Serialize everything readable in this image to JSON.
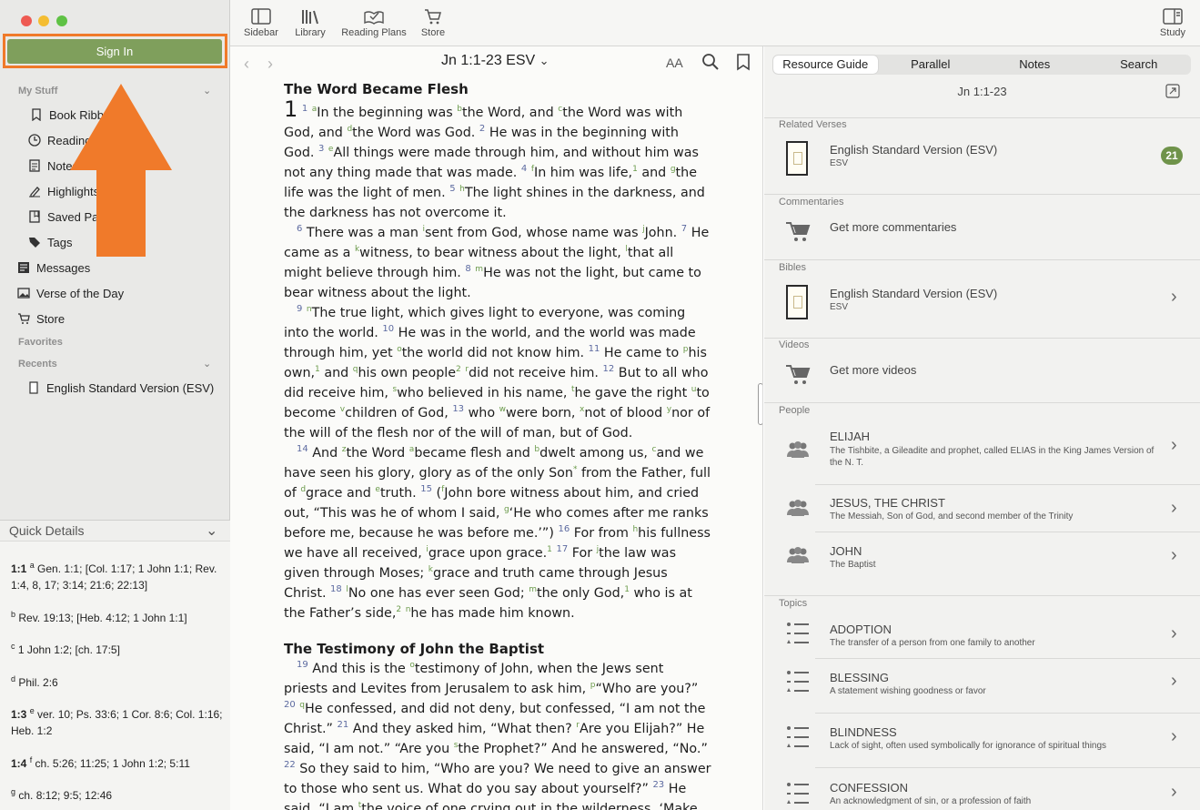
{
  "sidebar": {
    "sign_in": "Sign In",
    "my_stuff_label": "My Stuff",
    "my_stuff": [
      "Book Ribbons",
      "Reading Plans",
      "Notes",
      "Highlights",
      "Saved Passages",
      "Tags"
    ],
    "messages": "Messages",
    "verse_of_day": "Verse of the Day",
    "store": "Store",
    "favorites_label": "Favorites",
    "recents_label": "Recents",
    "recent_item": "English Standard Version (ESV)"
  },
  "quick_details": {
    "title": "Quick Details",
    "entries": [
      {
        "ref": "1:1",
        "note": "a",
        "text": "Gen. 1:1; [Col. 1:17; 1 John 1:1; Rev. 1:4, 8, 17; 3:14; 21:6; 22:13]"
      },
      {
        "ref": "",
        "note": "b",
        "text": "Rev. 19:13; [Heb. 4:12; 1 John 1:1]"
      },
      {
        "ref": "",
        "note": "c",
        "text": "1 John 1:2; [ch. 17:5]"
      },
      {
        "ref": "",
        "note": "d",
        "text": "Phil. 2:6"
      },
      {
        "ref": "1:3",
        "note": "e",
        "text": "ver. 10; Ps. 33:6; 1 Cor. 8:6; Col. 1:16; Heb. 1:2"
      },
      {
        "ref": "1:4",
        "note": "f",
        "text": "ch. 5:26; 11:25; 1 John 1:2; 5:11"
      },
      {
        "ref": "",
        "note": "g",
        "text": "ch. 8:12; 9:5; 12:46"
      }
    ]
  },
  "toolbar": {
    "sidebar": "Sidebar",
    "library": "Library",
    "reading_plans": "Reading Plans",
    "store": "Store",
    "study": "Study"
  },
  "reader": {
    "reference": "Jn 1:1-23 ESV",
    "font_label": "AA",
    "heading1": "The Word Became Flesh",
    "heading2": "The Testimony of John the Baptist"
  },
  "panel": {
    "tabs": [
      "Resource Guide",
      "Parallel",
      "Notes",
      "Search"
    ],
    "reference": "Jn 1:1-23",
    "related_verses": "Related Verses",
    "esv_title": "English Standard Version (ESV)",
    "esv_sub": "ESV",
    "related_count": "21",
    "commentaries": "Commentaries",
    "get_commentaries": "Get more commentaries",
    "bibles": "Bibles",
    "videos": "Videos",
    "get_videos": "Get more videos",
    "people": "People",
    "people_items": [
      {
        "name": "ELIJAH",
        "desc": "The Tishbite, a Gileadite and prophet, called ELIAS in the King James Version of the N. T."
      },
      {
        "name": "JESUS, THE CHRIST",
        "desc": "The Messiah, Son of God, and second member of the Trinity"
      },
      {
        "name": "JOHN",
        "desc": "The Baptist"
      }
    ],
    "topics": "Topics",
    "topic_items": [
      {
        "name": "ADOPTION",
        "desc": "The transfer of a person from one family to another"
      },
      {
        "name": "BLESSING",
        "desc": "A statement wishing goodness or favor"
      },
      {
        "name": "BLINDNESS",
        "desc": "Lack of sight, often used symbolically for ignorance of spiritual things"
      },
      {
        "name": "CONFESSION",
        "desc": "An acknowledgment of sin, or a profession of faith"
      }
    ]
  },
  "colors": {
    "accent_green": "#7f9f5c",
    "highlight_orange": "#f07a2a"
  }
}
